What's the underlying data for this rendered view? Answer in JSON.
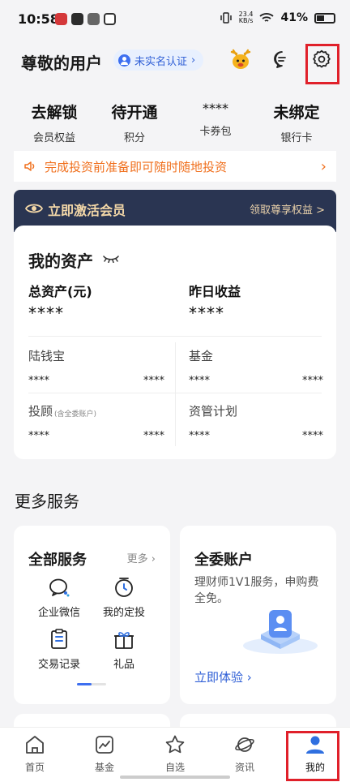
{
  "status_bar": {
    "time": "10:58",
    "net_speed_value": "23.4",
    "net_speed_unit": "KB/s",
    "battery": "41%"
  },
  "header": {
    "greeting": "尊敬的用户",
    "verify_label": "未实名认证"
  },
  "stats": [
    {
      "value": "去解锁",
      "label": "会员权益"
    },
    {
      "value": "待开通",
      "label": "积分"
    },
    {
      "value": "****",
      "label": "卡券包"
    },
    {
      "value": "未绑定",
      "label": "银行卡"
    }
  ],
  "notice": {
    "text": "完成投资前准备即可随时随地投资"
  },
  "member": {
    "title": "立即激活会员",
    "link": "领取尊享权益 >"
  },
  "assets": {
    "title": "我的资产",
    "total_label": "总资产(元)",
    "total_value": "****",
    "yesterday_label": "昨日收益",
    "yesterday_value": "****",
    "rows": [
      {
        "name": "陆钱宝",
        "a": "****",
        "b": "****"
      },
      {
        "name": "基金",
        "a": "****",
        "b": "****"
      },
      {
        "name": "投顾",
        "note": "(含全委账户)",
        "a": "****",
        "b": "****"
      },
      {
        "name": "资管计划",
        "a": "****",
        "b": "****"
      }
    ]
  },
  "more_services": {
    "title": "更多服务",
    "all": {
      "title": "全部服务",
      "more": "更多",
      "items": [
        {
          "label": "企业微信",
          "icon": "wechat-work-icon"
        },
        {
          "label": "我的定投",
          "icon": "clock-icon"
        },
        {
          "label": "交易记录",
          "icon": "clipboard-icon"
        },
        {
          "label": "礼品",
          "icon": "gift-icon"
        }
      ]
    },
    "delegate": {
      "title": "全委账户",
      "desc": "理财师1V1服务，申购费全免。",
      "cta": "立即体验"
    }
  },
  "bottom_nav": [
    {
      "label": "首页",
      "icon": "home-icon"
    },
    {
      "label": "基金",
      "icon": "chart-icon"
    },
    {
      "label": "自选",
      "icon": "star-icon"
    },
    {
      "label": "资讯",
      "icon": "planet-icon"
    },
    {
      "label": "我的",
      "icon": "user-icon",
      "active": true
    }
  ],
  "colors": {
    "accent": "#2f5fd6",
    "notice": "#f0701e",
    "member_bg": "#2a3552",
    "highlight": "#e0202a"
  }
}
